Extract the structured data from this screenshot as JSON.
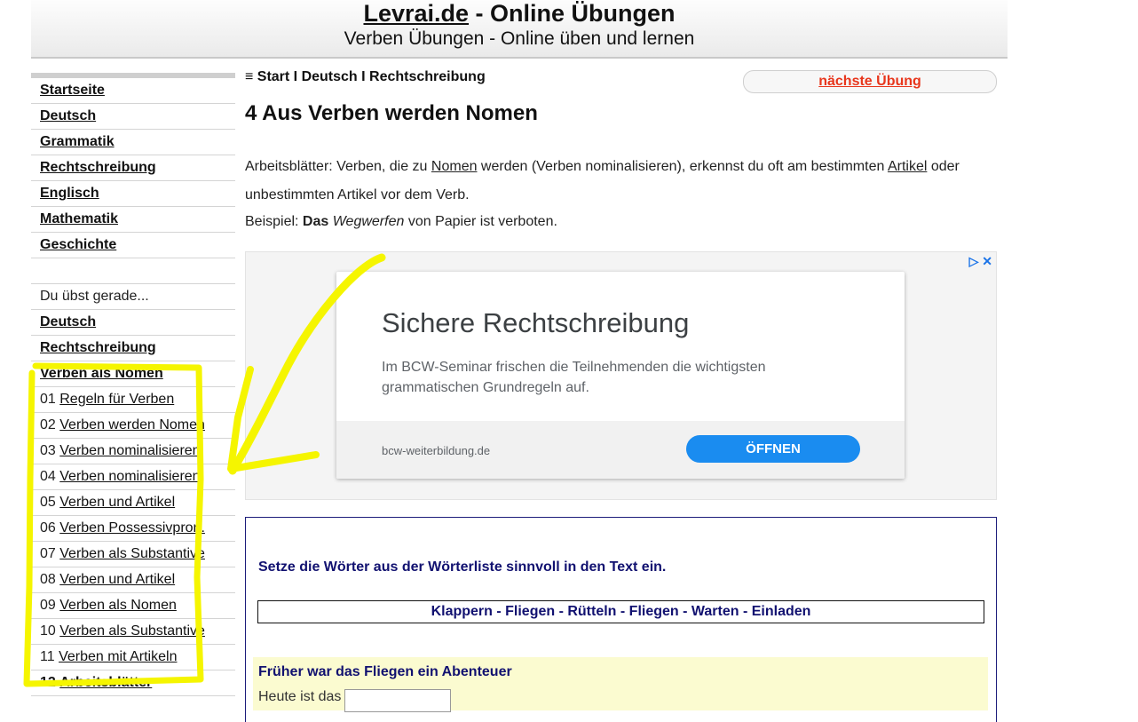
{
  "header": {
    "site_name": "Levrai.de",
    "site_title_rest": " - Online Übungen",
    "subtitle": "Verben Übungen  - Online üben und lernen"
  },
  "sidebar": {
    "nav": [
      "Startseite",
      "Deutsch",
      "Grammatik",
      "Rechtschreibung",
      "Englisch",
      "Mathematik",
      "Geschichte"
    ],
    "current_label": "Du übst gerade...",
    "current": [
      "Deutsch",
      "Rechtschreibung",
      "Verben als Nomen"
    ],
    "exercises": [
      {
        "num": "01",
        "label": "Regeln für Verben"
      },
      {
        "num": "02",
        "label": "Verben werden Nomen"
      },
      {
        "num": "03",
        "label": "Verben nominalisieren"
      },
      {
        "num": "04",
        "label": "Verben nominalisieren"
      },
      {
        "num": "05",
        "label": "Verben und Artikel"
      },
      {
        "num": "06",
        "label": "Verben Possessivpron."
      },
      {
        "num": "07",
        "label": "Verben als Substantive"
      },
      {
        "num": "08",
        "label": "Verben und Artikel"
      },
      {
        "num": "09",
        "label": "Verben als Nomen"
      },
      {
        "num": "10",
        "label": "Verben als Substantive"
      },
      {
        "num": "11",
        "label": "Verben mit Artikeln"
      },
      {
        "num": "12",
        "label": "Arbeitsblätter"
      }
    ]
  },
  "main": {
    "breadcrumb": "≡ Start I Deutsch I Rechtschreibung",
    "next_exercise": "nächste Übung",
    "title": "4 Aus Verben werden Nomen",
    "intro": {
      "part1": "Arbeitsblätter: Verben, die zu ",
      "link1": "Nomen",
      "part2": " werden (Verben nominalisieren), erkennst du oft am bestimmten ",
      "link2": "Artikel",
      "part3": " oder unbestimmten Artikel vor dem Verb."
    },
    "example": {
      "label": "Beispiel: ",
      "article": "Das",
      "word": "Wegwerfen",
      "rest": " von Papier ist verboten."
    }
  },
  "ad": {
    "controls": "▷ ✕",
    "headline": "Sichere Rechtschreibung",
    "description": "Im BCW-Seminar frischen die Teilnehmenden die wichtigsten grammatischen Grundregeln auf.",
    "domain": "bcw-weiterbildung.de",
    "button": "ÖFFNEN"
  },
  "exercise": {
    "instruction": "Setze die Wörter aus der Wörterliste sinnvoll in den Text ein.",
    "word_list": "Klappern - Fliegen - Rütteln - Fliegen - Warten - Einladen",
    "story_heading": "Früher war das Fliegen ein Abenteuer",
    "story_line_start": "Heute ist das"
  },
  "colors": {
    "next_link": "#e8361c",
    "exercise_text": "#111170",
    "highlight_scribble": "#f5f500",
    "ad_button": "#1a8cf0"
  }
}
